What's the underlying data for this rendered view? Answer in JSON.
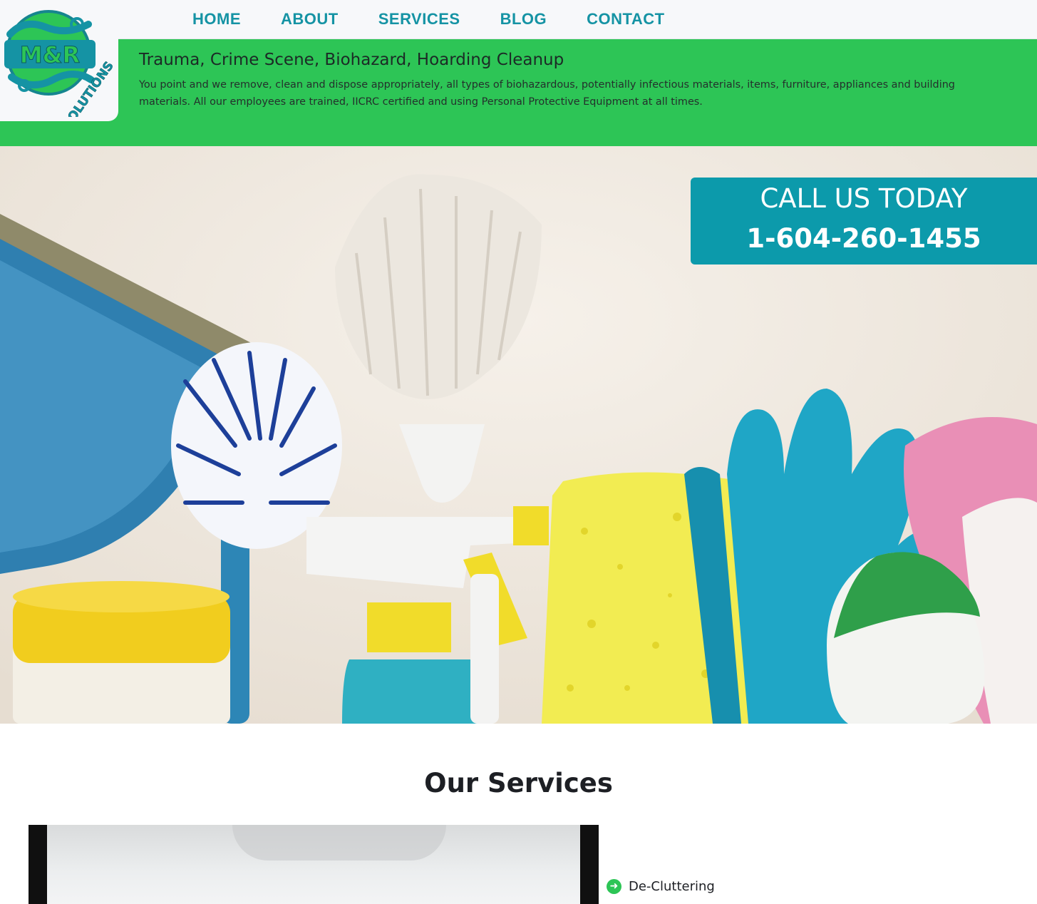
{
  "brand": {
    "logo_text_top": "M&R",
    "logo_text_bottom": "SOLUTIONS",
    "colors": {
      "teal": "#1593a4",
      "green": "#2dc556",
      "cta": "#0c9aab"
    }
  },
  "nav": {
    "items": [
      {
        "label": "HOME"
      },
      {
        "label": "ABOUT"
      },
      {
        "label": "SERVICES"
      },
      {
        "label": "BLOG"
      },
      {
        "label": "CONTACT"
      }
    ]
  },
  "header": {
    "title": "Trauma, Crime Scene, Biohazard, Hoarding Cleanup",
    "description": "You point and we remove, clean and dispose appropriately, all types of biohazardous, potentially infectious materials, items, furniture, appliances and building materials. All our employees are trained, IICRC certified and using Personal Protective Equipment at all times."
  },
  "cta": {
    "line1": "CALL US TODAY",
    "line2": "1-604-260-1455"
  },
  "services": {
    "title": "Our Services",
    "items": [
      {
        "label": "De-Cluttering",
        "icon": "arrow-right-circle-icon"
      }
    ]
  }
}
